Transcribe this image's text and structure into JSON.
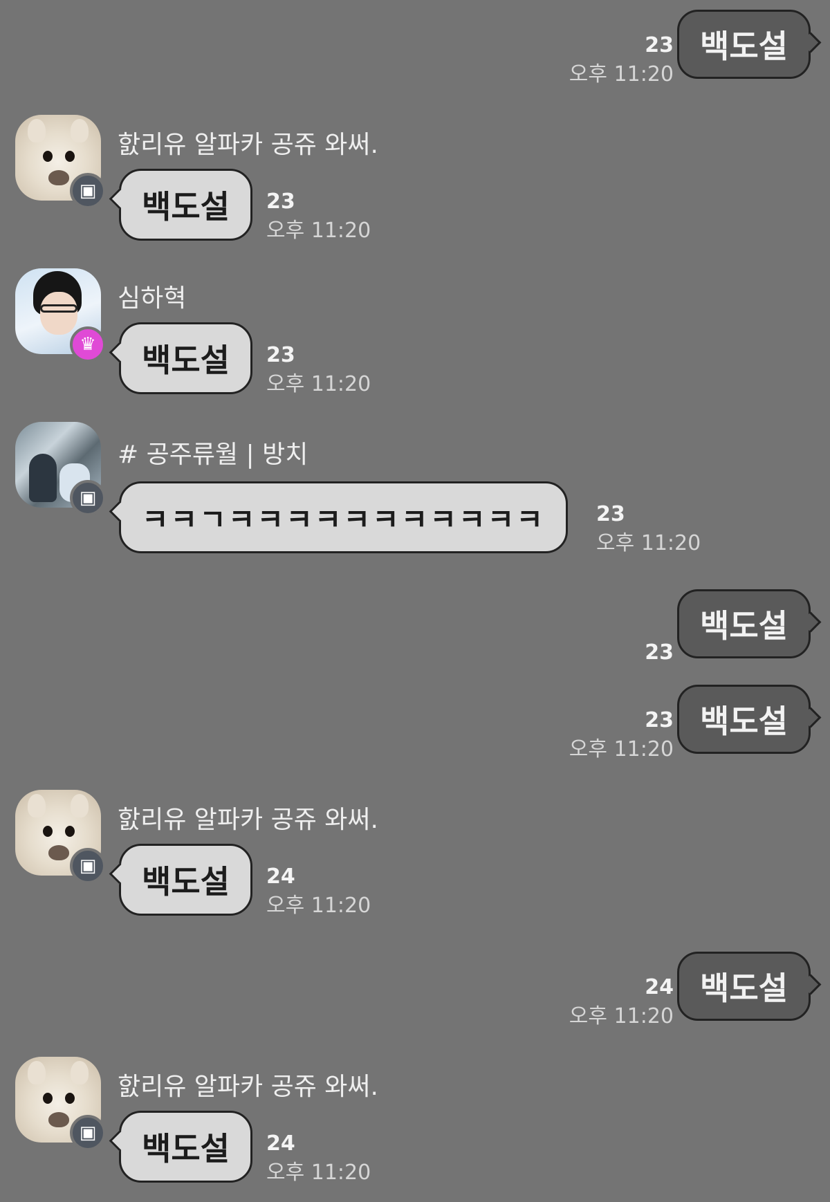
{
  "chat": {
    "messages": [
      {
        "direction": "out",
        "text": "백도설",
        "count": "23",
        "time": "오후 11:20"
      },
      {
        "direction": "in",
        "sender": "핤리유 알파카 공쥬 와써.",
        "text": "백도설",
        "count": "23",
        "time": "오후 11:20",
        "avatar_icon": "alpaca-avatar",
        "badge_icon": "open-chat-badge-icon"
      },
      {
        "direction": "in",
        "sender": "심하혁",
        "text": "백도설",
        "count": "23",
        "time": "오후 11:20",
        "avatar_icon": "person-avatar",
        "badge_icon": "crown-badge-icon"
      },
      {
        "direction": "in",
        "sender": "# 공주류월 | 방치",
        "text": "ㅋㅋㄱㅋㅋㅋㅋㅋㅋㅋㅋㅋㅋㅋ",
        "count": "23",
        "time": "오후 11:20",
        "avatar_icon": "photo-avatar",
        "badge_icon": "open-chat-badge-icon"
      },
      {
        "direction": "out",
        "text": "백도설",
        "count": "23",
        "time": ""
      },
      {
        "direction": "out",
        "text": "백도설",
        "count": "23",
        "time": "오후 11:20"
      },
      {
        "direction": "in",
        "sender": "핤리유 알파카 공쥬 와써.",
        "text": "백도설",
        "count": "24",
        "time": "오후 11:20",
        "avatar_icon": "alpaca-avatar",
        "badge_icon": "open-chat-badge-icon"
      },
      {
        "direction": "out",
        "text": "백도설",
        "count": "24",
        "time": "오후 11:20"
      },
      {
        "direction": "in",
        "sender": "핤리유 알파카 공쥬 와써.",
        "text": "백도설",
        "count": "24",
        "time": "오후 11:20",
        "avatar_icon": "alpaca-avatar",
        "badge_icon": "open-chat-badge-icon"
      }
    ]
  },
  "colors": {
    "background": "#747474",
    "outgoing_bubble": "#5a5a5a",
    "incoming_bubble": "#d9d9d9",
    "crown_badge": "#e04ad6",
    "open_chat_badge": "#4f5660"
  }
}
